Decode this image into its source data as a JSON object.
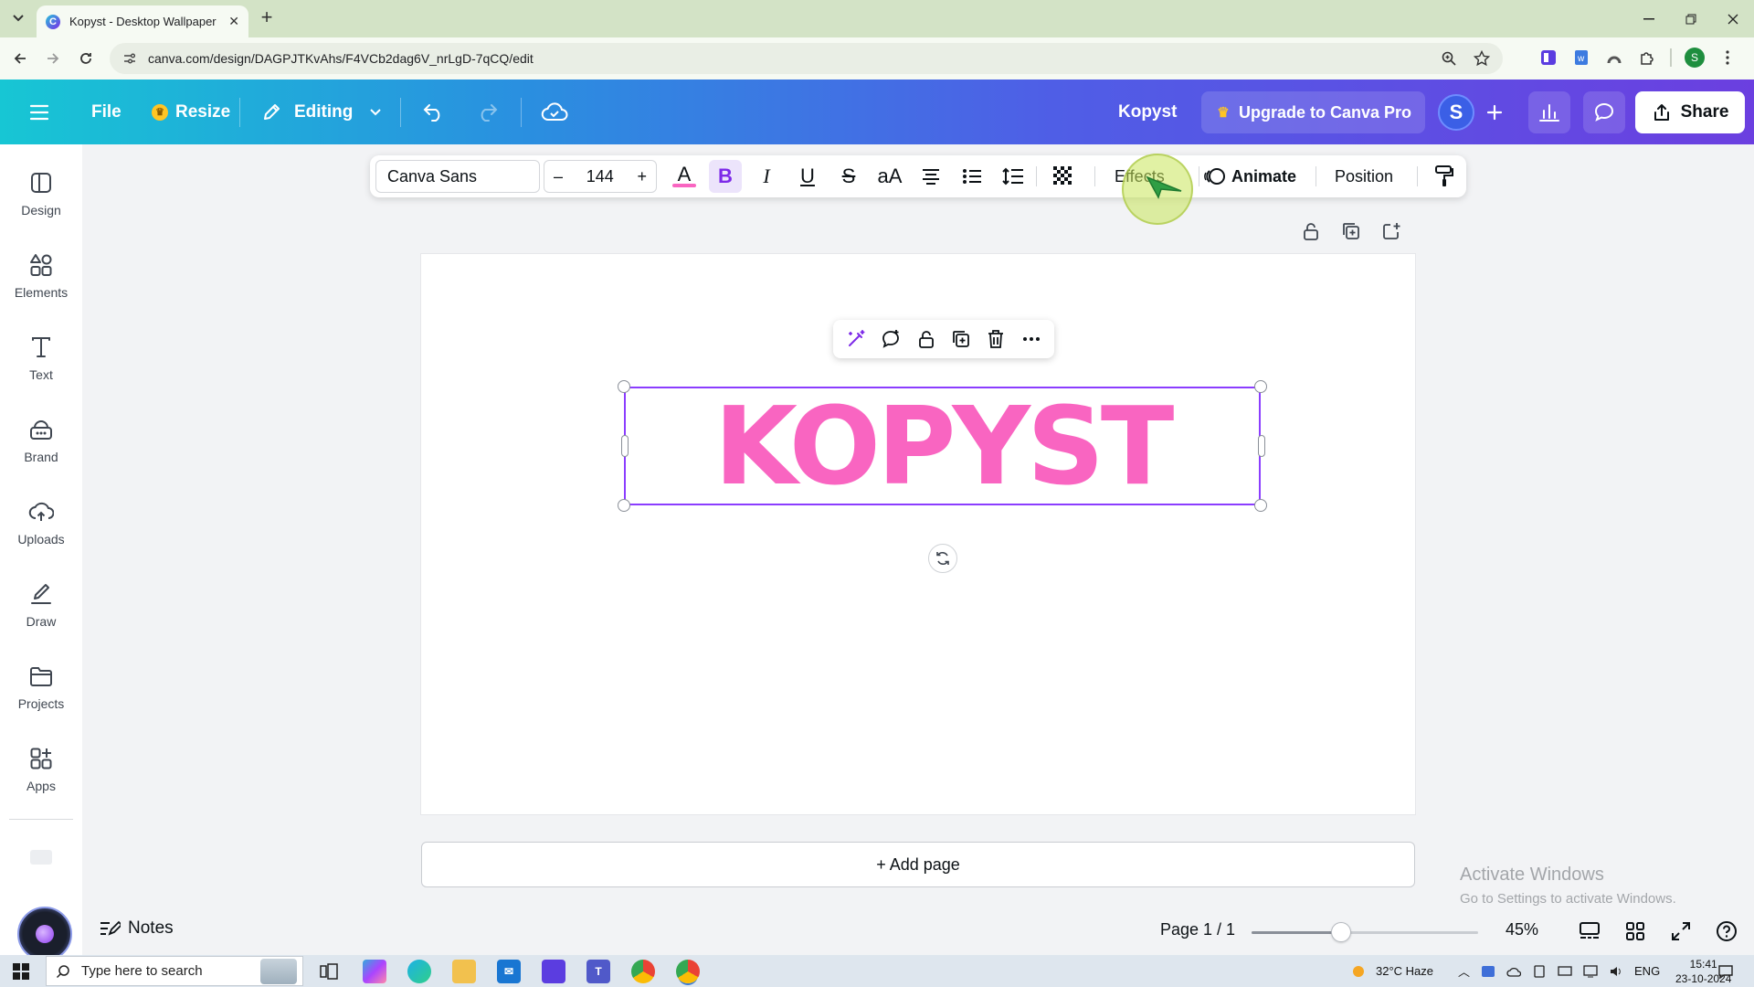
{
  "browser": {
    "tab_title": "Kopyst - Desktop Wallpaper - C",
    "url": "canva.com/design/DAGPJTKvAhs/F4VCb2dag6V_nrLgD-7qCQ/edit"
  },
  "header": {
    "file_label": "File",
    "resize_label": "Resize",
    "editing_label": "Editing",
    "doc_title": "Kopyst",
    "upgrade_label": "Upgrade to Canva Pro",
    "avatar_letter": "S",
    "share_label": "Share",
    "accent_color": "#7d2ae8"
  },
  "sidebar": {
    "items": [
      {
        "label": "Design",
        "icon": "design-icon"
      },
      {
        "label": "Elements",
        "icon": "elements-icon"
      },
      {
        "label": "Text",
        "icon": "text-icon"
      },
      {
        "label": "Brand",
        "icon": "brand-icon"
      },
      {
        "label": "Uploads",
        "icon": "uploads-icon"
      },
      {
        "label": "Draw",
        "icon": "draw-icon"
      },
      {
        "label": "Projects",
        "icon": "projects-icon"
      },
      {
        "label": "Apps",
        "icon": "apps-icon"
      }
    ]
  },
  "toolbar": {
    "font_family": "Canva Sans",
    "font_size": "144",
    "minus": "–",
    "plus": "+",
    "bold": "B",
    "italic": "I",
    "underline": "U",
    "strike": "S",
    "case": "aA",
    "effects_label": "Effects",
    "animate_label": "Animate",
    "position_label": "Position",
    "text_color": "#f965c1"
  },
  "canvas": {
    "text": "KOPYST",
    "text_color": "#f965c1",
    "selection_color": "#8b3dff",
    "add_page_label": "+ Add page"
  },
  "watermark": {
    "line1": "Activate Windows",
    "line2": "Go to Settings to activate Windows."
  },
  "bottombar": {
    "notes_label": "Notes",
    "page_info": "Page 1 / 1",
    "zoom_label": "45%",
    "zoom_fraction": 0.45
  },
  "taskbar": {
    "search_placeholder": "Type here to search",
    "weather": "32°C  Haze",
    "language": "ENG",
    "time": "15:41",
    "date": "23-10-2024"
  }
}
